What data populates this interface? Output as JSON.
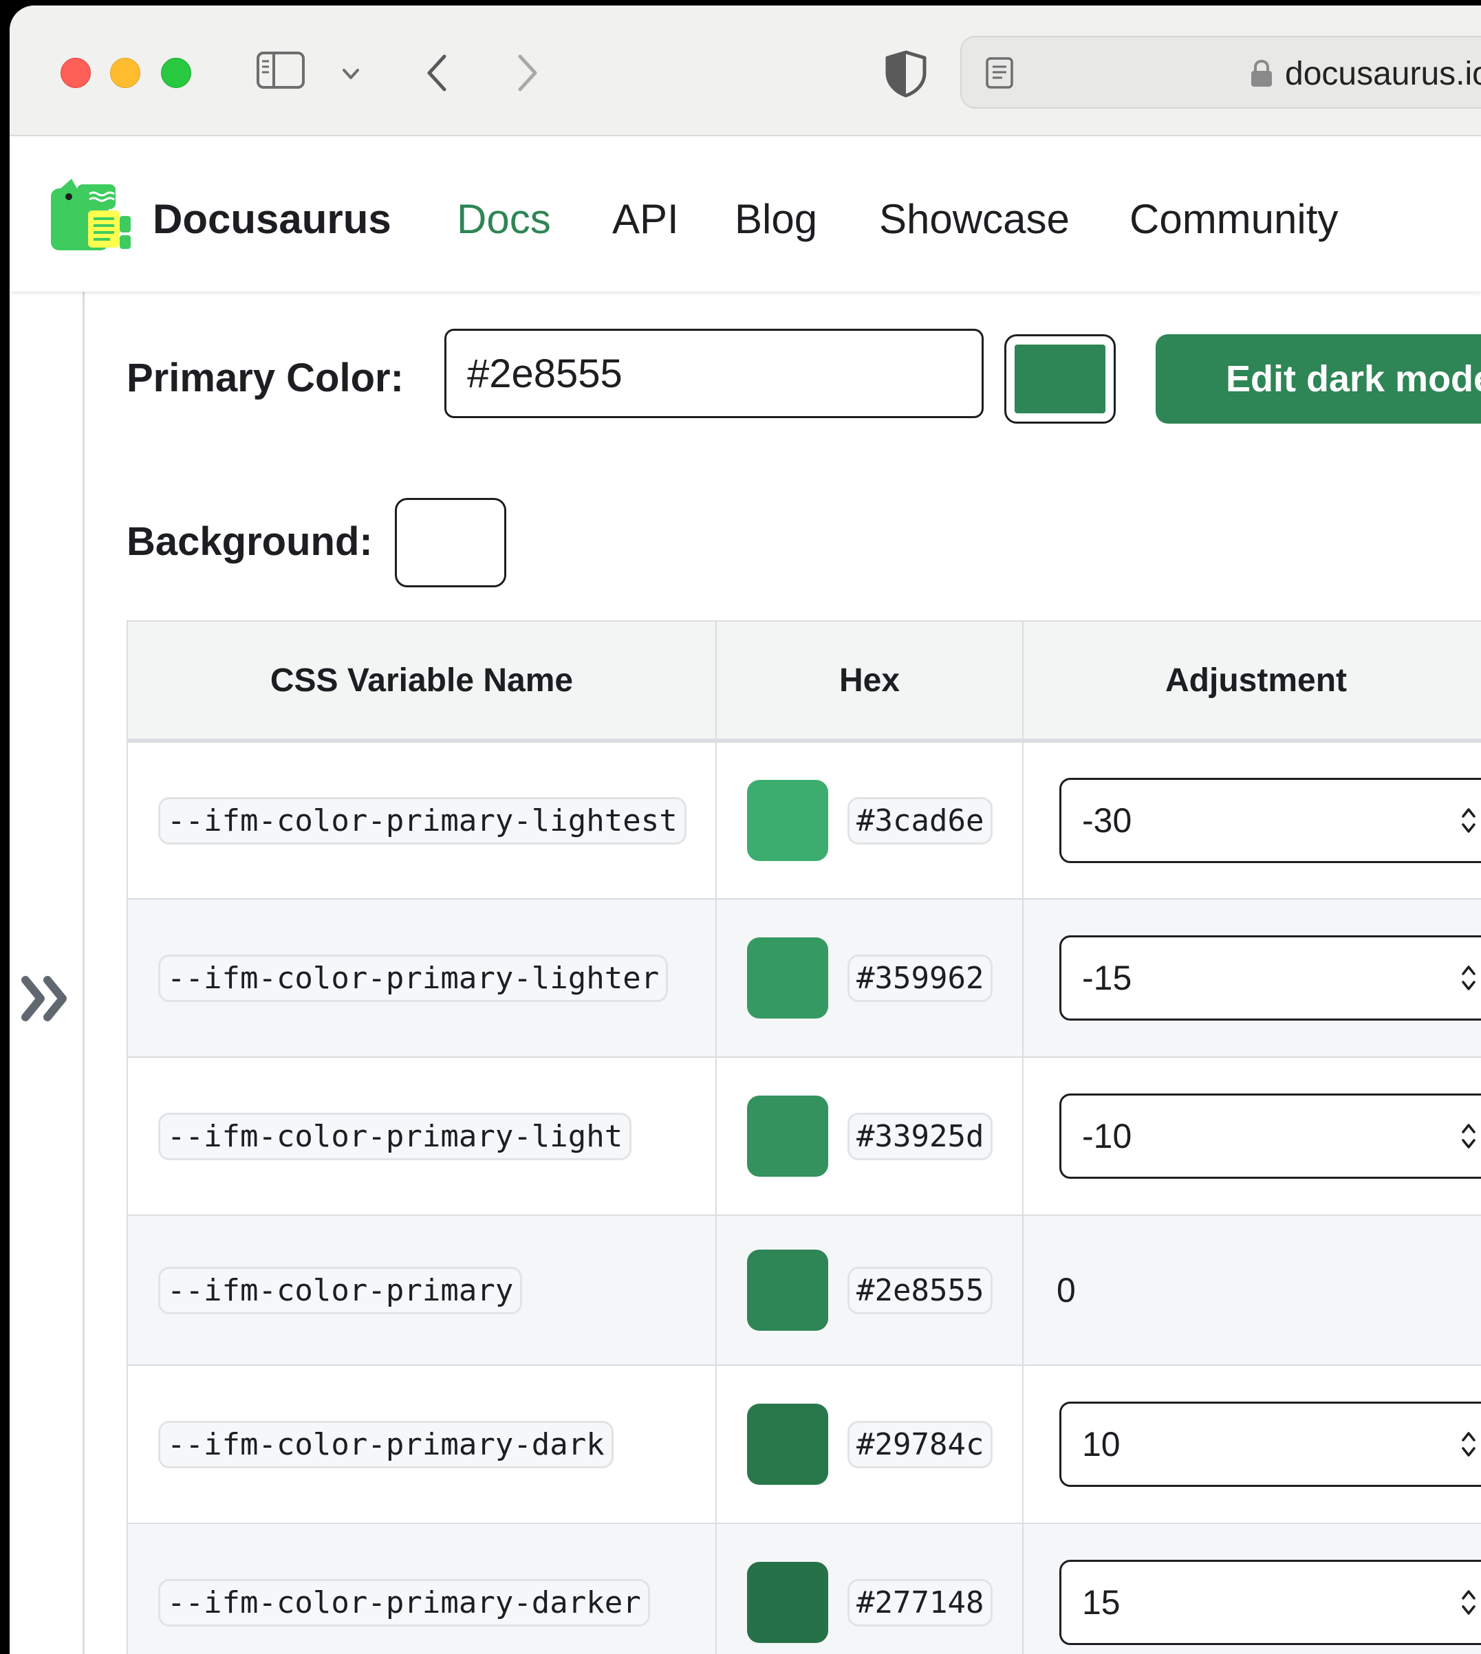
{
  "browser": {
    "url": "docusaurus.io",
    "icons": [
      "sidebar-icon",
      "chevron-down-icon",
      "back-icon",
      "forward-icon",
      "shield-icon",
      "reader-icon",
      "lock-icon"
    ]
  },
  "navbar": {
    "brand": "Docusaurus",
    "links": [
      "Docs",
      "API",
      "Blog",
      "Showcase",
      "Community"
    ],
    "active_link": "Docs",
    "accent_color": "#2e8555"
  },
  "editor": {
    "primary_label": "Primary Color:",
    "primary_value": "#2e8555",
    "primary_swatch": "#2e8555",
    "edit_dark_label": "Edit dark mode",
    "background_label": "Background:",
    "background_swatch": "#ffffff"
  },
  "table": {
    "headers": [
      "CSS Variable Name",
      "Hex",
      "Adjustment"
    ],
    "rows": [
      {
        "name": "--ifm-color-primary-lightest",
        "hex": "#3cad6e",
        "adjustment": "-30",
        "editable": true
      },
      {
        "name": "--ifm-color-primary-lighter",
        "hex": "#359962",
        "adjustment": "-15",
        "editable": true
      },
      {
        "name": "--ifm-color-primary-light",
        "hex": "#33925d",
        "adjustment": "-10",
        "editable": true
      },
      {
        "name": "--ifm-color-primary",
        "hex": "#2e8555",
        "adjustment": "0",
        "editable": false
      },
      {
        "name": "--ifm-color-primary-dark",
        "hex": "#29784c",
        "adjustment": "10",
        "editable": true
      },
      {
        "name": "--ifm-color-primary-darker",
        "hex": "#277148",
        "adjustment": "15",
        "editable": true
      }
    ]
  }
}
